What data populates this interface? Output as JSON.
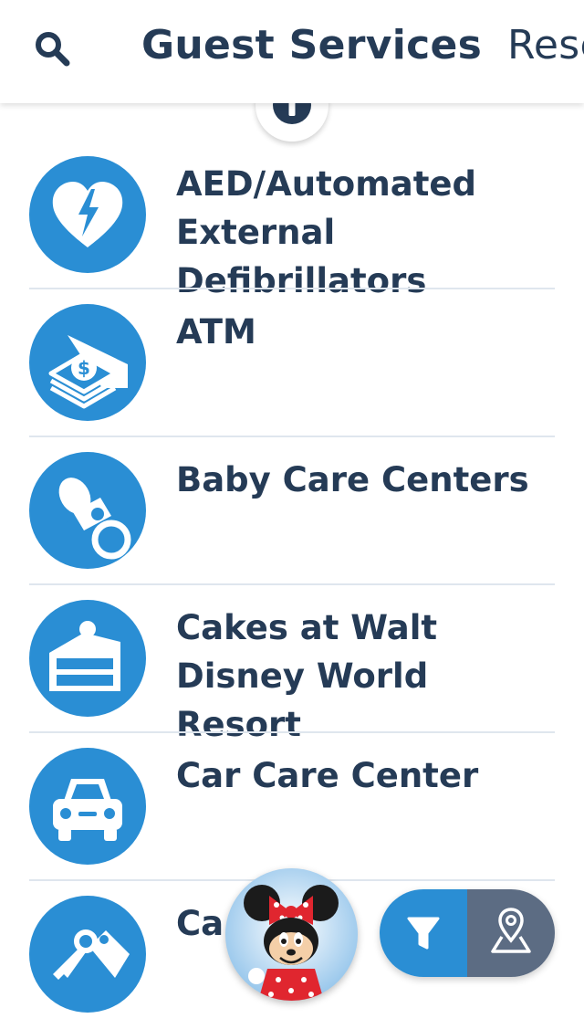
{
  "header": {
    "active_tab": "Guest Services",
    "next_tab": "Rese"
  },
  "list": {
    "items": [
      {
        "label": "AED/Automated External Defibrillators",
        "icon": "heart-lightning-icon"
      },
      {
        "label": "ATM",
        "icon": "atm-money-icon"
      },
      {
        "label": "Baby Care Centers",
        "icon": "pacifier-icon"
      },
      {
        "label": "Cakes at Walt Disney World Resort",
        "icon": "cake-slice-icon"
      },
      {
        "label": "Car Care Center",
        "icon": "car-icon"
      },
      {
        "label": "Ca",
        "icon": "key-tag-icon"
      }
    ]
  },
  "colors": {
    "accent": "#2a8ed4",
    "text": "#253b56",
    "map_button": "#5c6c83",
    "divider": "#dfe6ee"
  }
}
